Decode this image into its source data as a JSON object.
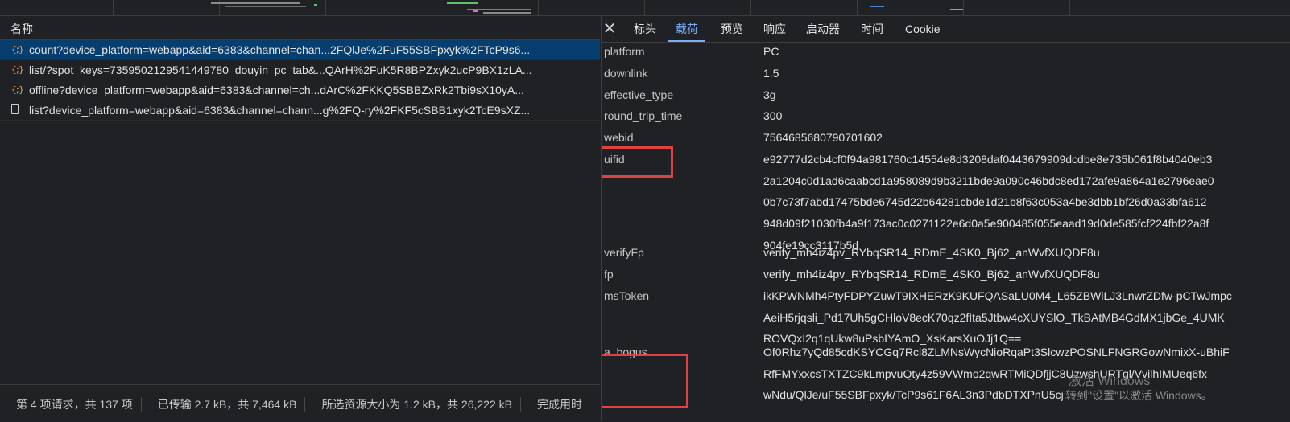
{
  "left_panel": {
    "column_header": "名称",
    "requests": [
      {
        "icon": "xhr-icon",
        "name": "count?device_platform=webapp&aid=6383&channel=chan...2FQlJe%2FuF55SBFpxyk%2FTcP9s6...",
        "selected": true
      },
      {
        "icon": "xhr-icon",
        "name": "list/?spot_keys=7359502129541449780_douyin_pc_tab&...QArH%2FuK5R8BPZxyk2ucP9BX1zLA...",
        "selected": false
      },
      {
        "icon": "xhr-icon",
        "name": "offline?device_platform=webapp&aid=6383&channel=ch...dArC%2FKKQ5SBBZxRk2Tbi9sX10yA...",
        "selected": false
      },
      {
        "icon": "document-icon",
        "name": "list?device_platform=webapp&aid=6383&channel=chann...g%2FQ-ry%2FKF5cSBB1xyk2TcE9sXZ...",
        "selected": false
      }
    ],
    "status": {
      "requests": "第 4 项请求，共 137 项",
      "transferred": "已传输 2.7 kB，共 7,464 kB",
      "resources": "所选资源大小为 1.2 kB，共 26,222 kB",
      "finish": "完成用时"
    }
  },
  "right_panel": {
    "close_label": "✕",
    "tabs": [
      {
        "label": "标头",
        "active": false
      },
      {
        "label": "载荷",
        "active": true
      },
      {
        "label": "预览",
        "active": false
      },
      {
        "label": "响应",
        "active": false
      },
      {
        "label": "启动器",
        "active": false
      },
      {
        "label": "时间",
        "active": false
      },
      {
        "label": "Cookie",
        "active": false
      }
    ],
    "params": [
      {
        "key": "platform",
        "value": "PC"
      },
      {
        "key": "downlink",
        "value": "1.5"
      },
      {
        "key": "effective_type",
        "value": "3g"
      },
      {
        "key": "round_trip_time",
        "value": "300"
      },
      {
        "key": "webid",
        "value": "7564685680790701602"
      },
      {
        "key": "uifid",
        "value_lines": [
          "e92777d2cb4cf0f94a981760c14554e8d3208daf0443679909dcdbe8e735b061f8b4040eb3",
          "2a1204c0d1ad6caabcd1a958089d9b3211bde9a090c46bdc8ed172afe9a864a1e2796eae0",
          "0b7c73f7abd17475bde6745d22b64281cbde1d21b8f63c053a4be3dbb1bf26d0a33bfa612",
          "948d09f21030fb4a9f173ac0c0271122e6d0a5e900485f055eaad19d0de585fcf224fbf22a8f",
          "904fe19cc3117b5d"
        ]
      },
      {
        "key": "verifyFp",
        "value": "verify_mh4iz4pv_RYbqSR14_RDmE_4SK0_Bj62_anWvfXUQDF8u"
      },
      {
        "key": "fp",
        "value": "verify_mh4iz4pv_RYbqSR14_RDmE_4SK0_Bj62_anWvfXUQDF8u"
      },
      {
        "key": "msToken",
        "value_lines": [
          "ikKPWNMh4PtyFDPYZuwT9IXHERzK9KUFQASaLU0M4_L65ZBWiLJ3LnwrZDfw-pCTwJmpc",
          "AeiH5rjqsli_Pd17Uh5gCHloV8ecK70qz2fIta5Jtbw4cXUYSlO_TkBAtMB4GdMX1jbGe_4UMK",
          "ROVQxI2q1qUkw8uPsbIYAmO_XsKarsXuOJj1Q=="
        ]
      },
      {
        "key": "a_bogus",
        "value_lines": [
          "Of0Rhz7yQd85cdKSYCGq7Rcl8ZLMNsWycNioRqaPt3SlcwzPOSNLFNGRGowNmixX-uBhiF",
          "RfFMYxxcsTXTZC9kLmpvuQty4z59VWmo2qwRTMiQDfjjC8UzwshURTgl/VvilhIMUeq6fx",
          "wNdu/QlJe/uF55SBFpxyk/TcP9s61F6AL3n3PdbDTXPnU5cj"
        ]
      }
    ]
  },
  "watermark": {
    "line1": "激活 Windows",
    "line2": "转到\"设置\"以激活 Windows。"
  },
  "colors": {
    "accent": "#7cacf8",
    "selected_row": "#063f6f",
    "highlight_box": "#e04141",
    "xhr_icon": "#e8a349"
  }
}
